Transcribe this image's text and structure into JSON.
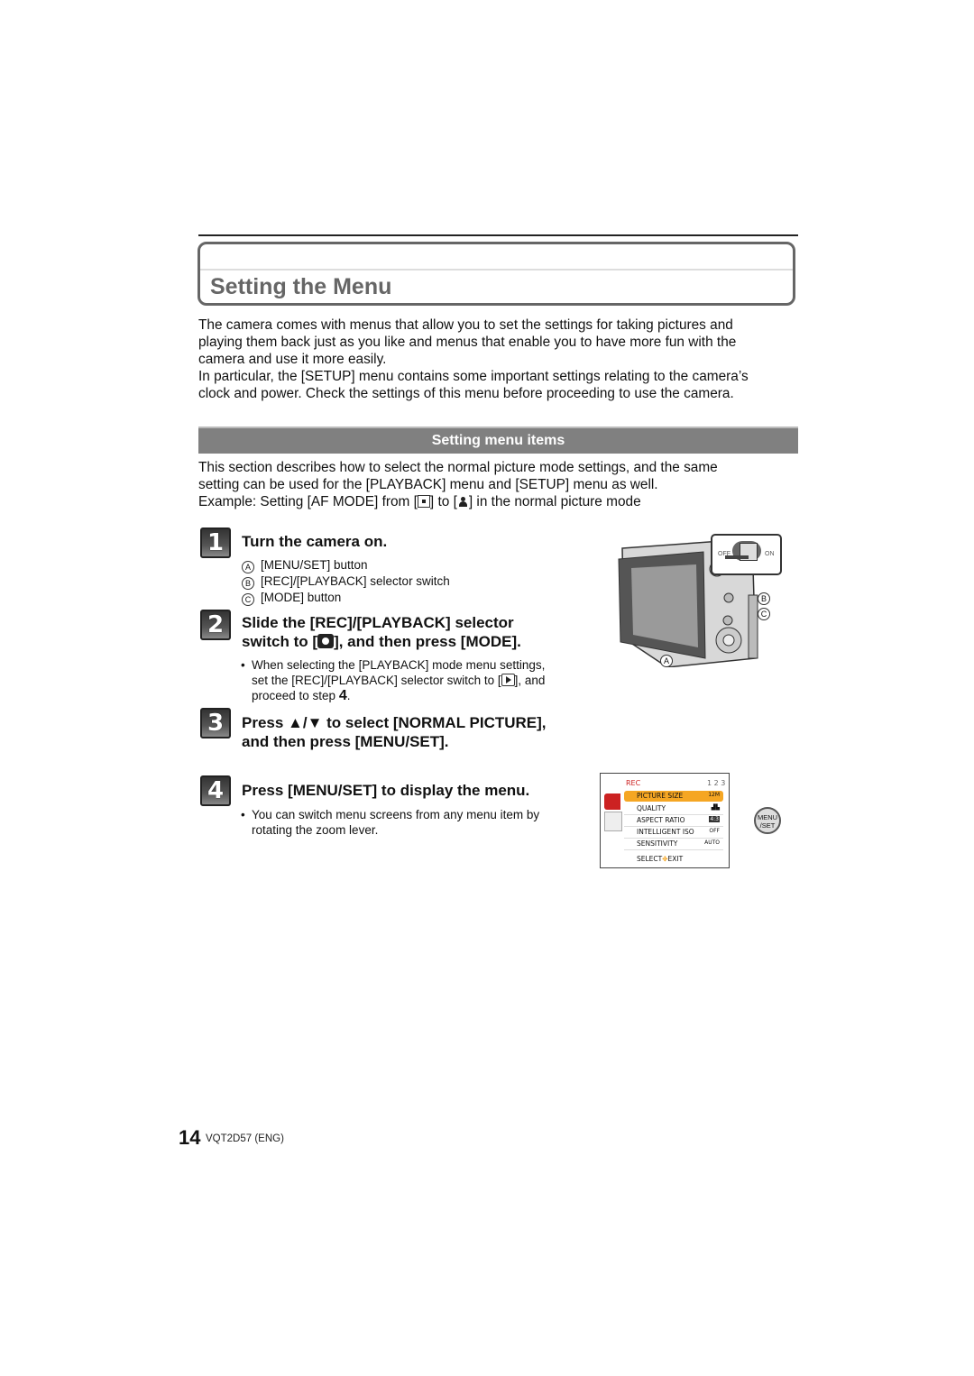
{
  "page": {
    "title": "Setting the Menu",
    "intro_paragraphs": [
      [
        "The camera comes with menus that allow you to set the settings for taking pictures and",
        "playing them back just as you like and menus that enable you to have more fun with the",
        "camera and use it more easily."
      ],
      [
        "In particular, the [SETUP] menu contains some important settings relating to the camera’s",
        "clock and power. Check the settings of this menu before proceeding to use the camera."
      ]
    ],
    "section": {
      "heading": "Setting menu items",
      "lines": [
        "This section describes how to select the normal picture mode settings, and the same",
        "setting can be used for the [PLAYBACK] menu and [SETUP] menu as well."
      ],
      "example_prefix": "Example: Setting [AF MODE] from [",
      "example_mid": "] to [",
      "example_suffix": "] in the normal picture mode",
      "example_icons": [
        "single-area-af-icon",
        "face-detection-af-icon"
      ]
    },
    "steps": [
      {
        "number": "1",
        "title": "Turn the camera on.",
        "items": [
          {
            "marker": "A",
            "text": "[MENU/SET] button"
          },
          {
            "marker": "B",
            "text": "[REC]/[PLAYBACK] selector switch"
          },
          {
            "marker": "C",
            "text": "[MODE] button"
          }
        ]
      },
      {
        "number": "2",
        "title_line1": "Slide the [REC]/[PLAYBACK] selector",
        "title_line2_pre": "switch to [",
        "title_line2_post": "], and then press [MODE].",
        "bullet_line1": "When selecting the [PLAYBACK] mode menu settings,",
        "bullet_line2_pre": "set the [REC]/[PLAYBACK] selector switch to [",
        "bullet_line2_post": "], and",
        "bullet_line3_pre": "proceed to step ",
        "bullet_line3_step": "4",
        "bullet_line3_post": "."
      },
      {
        "number": "3",
        "title_line1": "Press ▲/▼ to select [NORMAL PICTURE],",
        "title_line2": "and then press [MENU/SET]."
      },
      {
        "number": "4",
        "title": "Press [MENU/SET] to display the menu.",
        "bullet_line1": "You can switch menu screens from any menu item by",
        "bullet_line2": "rotating the zoom lever."
      }
    ],
    "camera_figure": {
      "switch_off": "OFF",
      "switch_on": "ON",
      "callouts": [
        "A",
        "B",
        "C"
      ]
    },
    "menu_screen": {
      "header": "REC",
      "page_indicator": [
        "1",
        "2",
        "3"
      ],
      "items": [
        {
          "label": "PICTURE SIZE",
          "value": "12M",
          "selected": true
        },
        {
          "label": "QUALITY",
          "value": "▟▙"
        },
        {
          "label": "ASPECT RATIO",
          "value": "4:3"
        },
        {
          "label": "INTELLIGENT ISO",
          "value": "OFF"
        },
        {
          "label": "SENSITIVITY",
          "value": "AUTO"
        }
      ],
      "footer_select": "SELECT",
      "footer_exit": "EXIT",
      "highlight_color": "#f5a623",
      "tab_color": "#cc2222"
    },
    "menu_set_button": {
      "line1": "MENU",
      "line2": "/SET"
    },
    "footer": {
      "page_number": "14",
      "code": "VQT2D57 (ENG)"
    }
  }
}
